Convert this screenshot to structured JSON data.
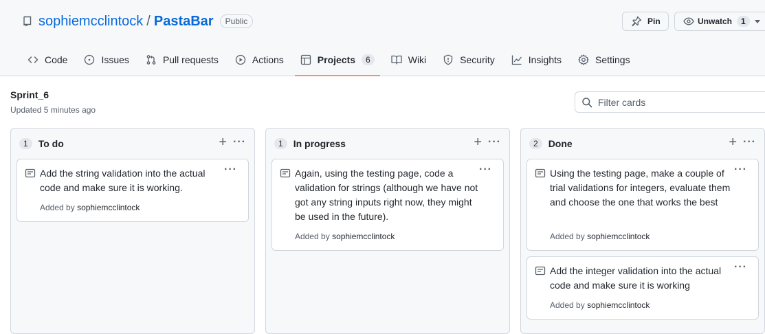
{
  "repo": {
    "owner": "sophiemcclintock",
    "separator": "/",
    "name": "PastaBar",
    "visibility": "Public",
    "icon": "repo-icon"
  },
  "actions": {
    "pin_label": "Pin",
    "watch_label": "Unwatch",
    "watch_count": "1"
  },
  "tabs": [
    {
      "label": "Code",
      "icon": "code-icon"
    },
    {
      "label": "Issues",
      "icon": "issue-icon"
    },
    {
      "label": "Pull requests",
      "icon": "pull-request-icon"
    },
    {
      "label": "Actions",
      "icon": "play-icon"
    },
    {
      "label": "Projects",
      "icon": "table-icon",
      "count": "6",
      "selected": true
    },
    {
      "label": "Wiki",
      "icon": "book-icon"
    },
    {
      "label": "Security",
      "icon": "shield-icon"
    },
    {
      "label": "Insights",
      "icon": "graph-icon"
    },
    {
      "label": "Settings",
      "icon": "gear-icon"
    }
  ],
  "board": {
    "title": "Sprint_6",
    "updated": "Updated 5 minutes ago",
    "filter_placeholder": "Filter cards"
  },
  "columns": [
    {
      "count": "1",
      "name": "To do",
      "cards": [
        {
          "text": "Add the string validation into the actual code and make sure it is working.",
          "added_by_label": "Added by",
          "author": "sophiemcclintock"
        }
      ]
    },
    {
      "count": "1",
      "name": "In progress",
      "cards": [
        {
          "text": "Again, using the testing page, code a validation for strings (although we have not got any string inputs right now, they might be used in the future).",
          "added_by_label": "Added by",
          "author": "sophiemcclintock"
        }
      ]
    },
    {
      "count": "2",
      "name": "Done",
      "cards": [
        {
          "text": "Using the testing page, make a couple of trial validations for integers, evaluate them and choose the one that works the best",
          "added_by_label": "Added by",
          "author": "sophiemcclintock"
        },
        {
          "text": "Add the integer validation into the actual code and make sure it is working",
          "added_by_label": "Added by",
          "author": "sophiemcclintock"
        }
      ]
    }
  ],
  "colors": {
    "link": "#0969da",
    "selected_tab_underline": "#fd8c73",
    "border": "#d0d7de",
    "column_bg": "#f6f8fa"
  }
}
